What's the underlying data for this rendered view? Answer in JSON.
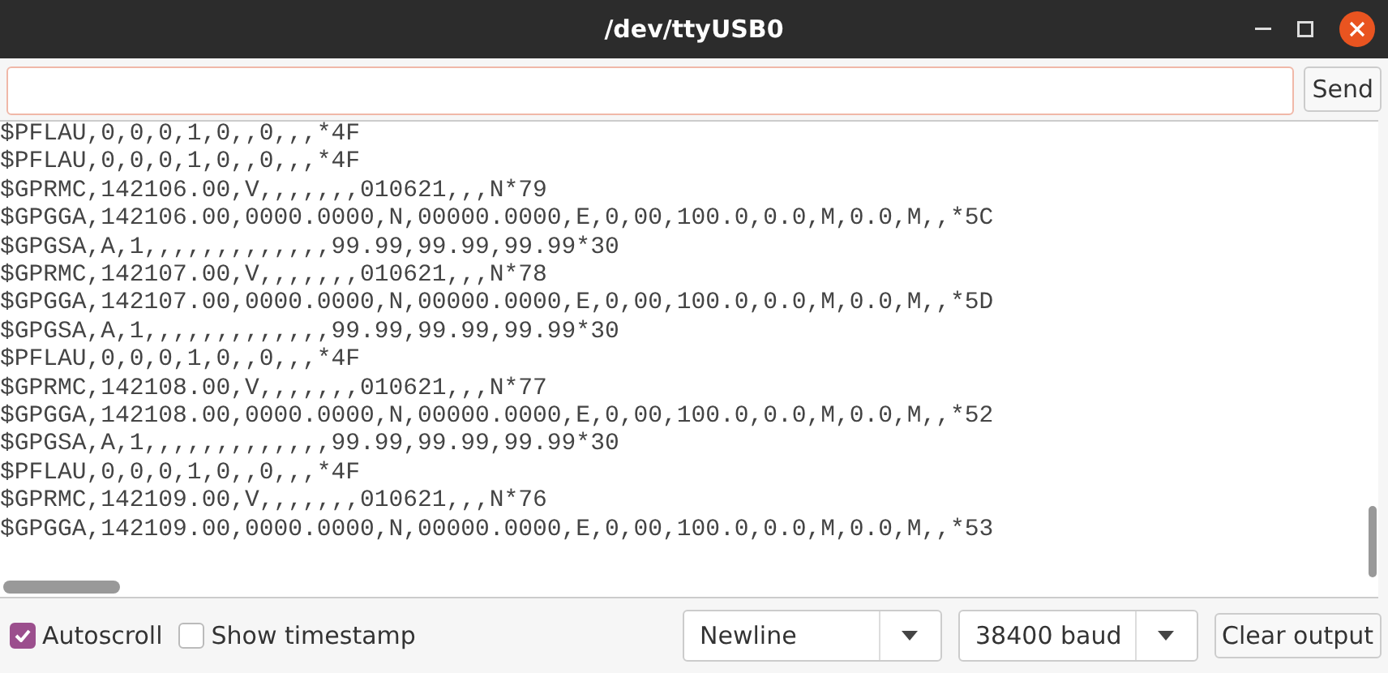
{
  "window": {
    "title": "/dev/ttyUSB0"
  },
  "input": {
    "button": "Send"
  },
  "output": {
    "lines": [
      "$PFLAU,0,0,0,1,0,,0,,,*4F",
      "$PFLAU,0,0,0,1,0,,0,,,*4F",
      "$GPRMC,142106.00,V,,,,,,,010621,,,N*79",
      "$GPGGA,142106.00,0000.0000,N,00000.0000,E,0,00,100.0,0.0,M,0.0,M,,*5C",
      "$GPGSA,A,1,,,,,,,,,,,,,99.99,99.99,99.99*30",
      "$GPRMC,142107.00,V,,,,,,,010621,,,N*78",
      "$GPGGA,142107.00,0000.0000,N,00000.0000,E,0,00,100.0,0.0,M,0.0,M,,*5D",
      "$GPGSA,A,1,,,,,,,,,,,,,99.99,99.99,99.99*30",
      "$PFLAU,0,0,0,1,0,,0,,,*4F",
      "$GPRMC,142108.00,V,,,,,,,010621,,,N*77",
      "$GPGGA,142108.00,0000.0000,N,00000.0000,E,0,00,100.0,0.0,M,0.0,M,,*52",
      "$GPGSA,A,1,,,,,,,,,,,,,99.99,99.99,99.99*30",
      "$PFLAU,0,0,0,1,0,,0,,,*4F",
      "$GPRMC,142109.00,V,,,,,,,010621,,,N*76",
      "$GPGGA,142109.00,0000.0000,N,00000.0000,E,0,00,100.0,0.0,M,0.0,M,,*53"
    ]
  },
  "footer": {
    "autoscroll": {
      "label": "Autoscroll",
      "checked": true
    },
    "timestamp": {
      "label": "Show timestamp",
      "checked": false
    },
    "line_ending": "Newline",
    "baud": "38400 baud",
    "clear_button": "Clear output"
  }
}
